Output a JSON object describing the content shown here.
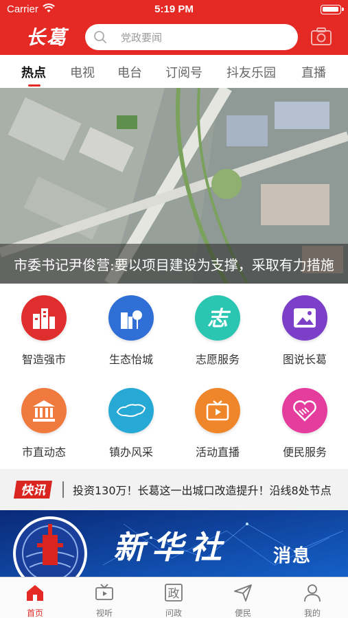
{
  "status_bar": {
    "carrier": "Carrier",
    "time": "5:19 PM"
  },
  "header": {
    "logo": "长葛",
    "search_placeholder": "党政要闻"
  },
  "tabs": [
    {
      "label": "热点",
      "active": true
    },
    {
      "label": "电视"
    },
    {
      "label": "电台"
    },
    {
      "label": "订阅号"
    },
    {
      "label": "抖友乐园"
    },
    {
      "label": "直播"
    }
  ],
  "banner": {
    "caption": "市委书记尹俊营:要以项目建设为支撑，采取有力措施"
  },
  "grid": [
    {
      "label": "智造强市",
      "icon": "buildings-icon",
      "color": "#e02d2d"
    },
    {
      "label": "生态怡城",
      "icon": "eco-city-icon",
      "color": "#2f6fd6"
    },
    {
      "label": "志愿服务",
      "icon": "volunteer-icon",
      "color": "#2bc6b2"
    },
    {
      "label": "图说长葛",
      "icon": "picture-icon",
      "color": "#7b3fc8"
    },
    {
      "label": "市直动态",
      "icon": "government-building-icon",
      "color": "#f07a3d"
    },
    {
      "label": "镇办风采",
      "icon": "map-icon",
      "color": "#27a9d6"
    },
    {
      "label": "活动直播",
      "icon": "live-tv-icon",
      "color": "#f0862a"
    },
    {
      "label": "便民服务",
      "icon": "handshake-heart-icon",
      "color": "#e43d9e"
    }
  ],
  "news_flash": {
    "badge": "快讯",
    "text": "投资130万！长葛这一出城口改造提升！沿线8处节点"
  },
  "ad": {
    "title": "新华社",
    "subtitle": "消息"
  },
  "bottom_nav": [
    {
      "label": "首页",
      "active": true
    },
    {
      "label": "视听"
    },
    {
      "label": "问政",
      "glyph": "政"
    },
    {
      "label": "便民"
    },
    {
      "label": "我的"
    }
  ],
  "colors": {
    "brand_red": "#e52a25"
  }
}
